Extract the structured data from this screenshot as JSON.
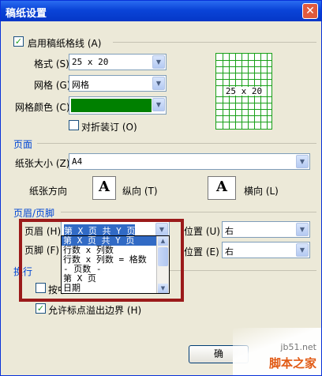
{
  "window": {
    "title": "稿纸设置",
    "close_glyph": "✕"
  },
  "enable_grid": {
    "label": "启用稿纸格线 (A)",
    "checked_glyph": "✓"
  },
  "format": {
    "label": "格式 (S)",
    "value": "25 x 20"
  },
  "grid": {
    "label": "网格 (G)",
    "value": "网格"
  },
  "grid_color": {
    "label": "网格颜色 (C)",
    "color": "#008000"
  },
  "fold": {
    "label": "对折装订 (O)"
  },
  "preview": {
    "text": "25 x 20"
  },
  "page_section": {
    "title": "页面"
  },
  "paper_size": {
    "label": "纸张大小 (Z)",
    "value": "A4"
  },
  "orientation": {
    "label": "纸张方向",
    "portrait_label": "纵向 (T)",
    "landscape_label": "横向 (L)",
    "icon_glyph": "A"
  },
  "header_footer_section": {
    "title": "页眉/页脚"
  },
  "header": {
    "label": "页眉 (H)",
    "value": "第 X 页 共 Y 页",
    "position_label": "位置 (U)",
    "position_value": "右"
  },
  "footer": {
    "label": "页脚 (F)",
    "position_label": "位置 (E)",
    "position_value": "右"
  },
  "dropdown": {
    "items": [
      "第 X 页 共 Y 页",
      "行数 x 列数",
      "行数 x 列数 = 格数",
      "- 页数 -",
      "第 X 页",
      "日期"
    ],
    "selected_index": 0
  },
  "wrap_section": {
    "title": "换行"
  },
  "wrap": {
    "option1_label": "按中",
    "option2_label": "允许标点溢出边界 (H)"
  },
  "buttons": {
    "ok_label": "确"
  },
  "watermark": {
    "site": "jb51.net",
    "brand": "脚本之家"
  }
}
